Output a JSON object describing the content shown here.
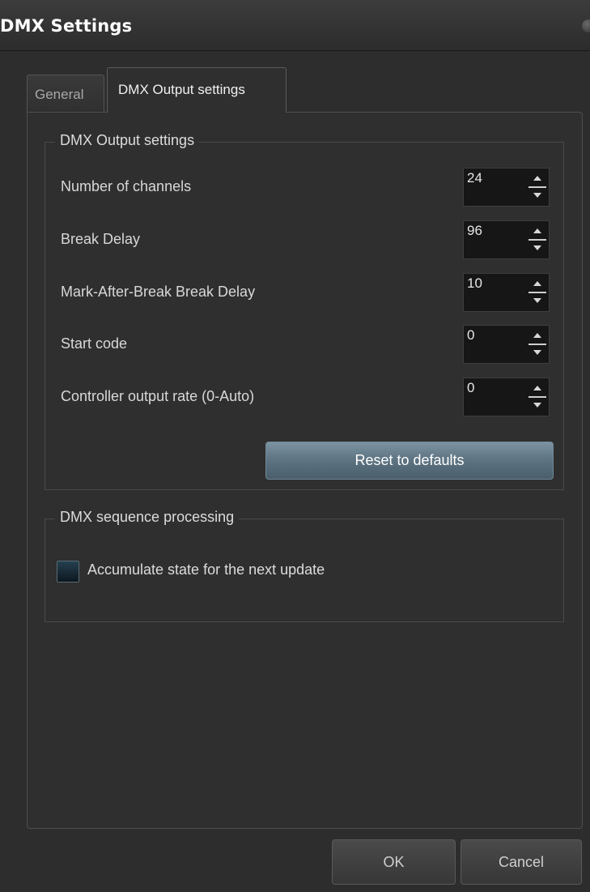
{
  "window": {
    "title": "DMX Settings"
  },
  "tabs": [
    {
      "label": "General",
      "active": false
    },
    {
      "label": "DMX Output settings",
      "active": true
    }
  ],
  "output_group": {
    "title": "DMX Output settings",
    "fields": [
      {
        "label": "Number of channels",
        "value": "24"
      },
      {
        "label": "Break Delay",
        "value": "96"
      },
      {
        "label": "Mark-After-Break Break Delay",
        "value": "10"
      },
      {
        "label": "Start code",
        "value": "0"
      },
      {
        "label": "Controller output rate (0-Auto)",
        "value": "0"
      }
    ],
    "reset_label": "Reset to defaults"
  },
  "sequence_group": {
    "title": "DMX sequence processing",
    "checkbox_label": "Accumulate state for the next update",
    "checked": false
  },
  "footer": {
    "ok_label": "OK",
    "cancel_label": "Cancel"
  },
  "colors": {
    "background": "#2d2d2d",
    "accent_button": "#5f7583",
    "text": "#d8d8d8"
  }
}
